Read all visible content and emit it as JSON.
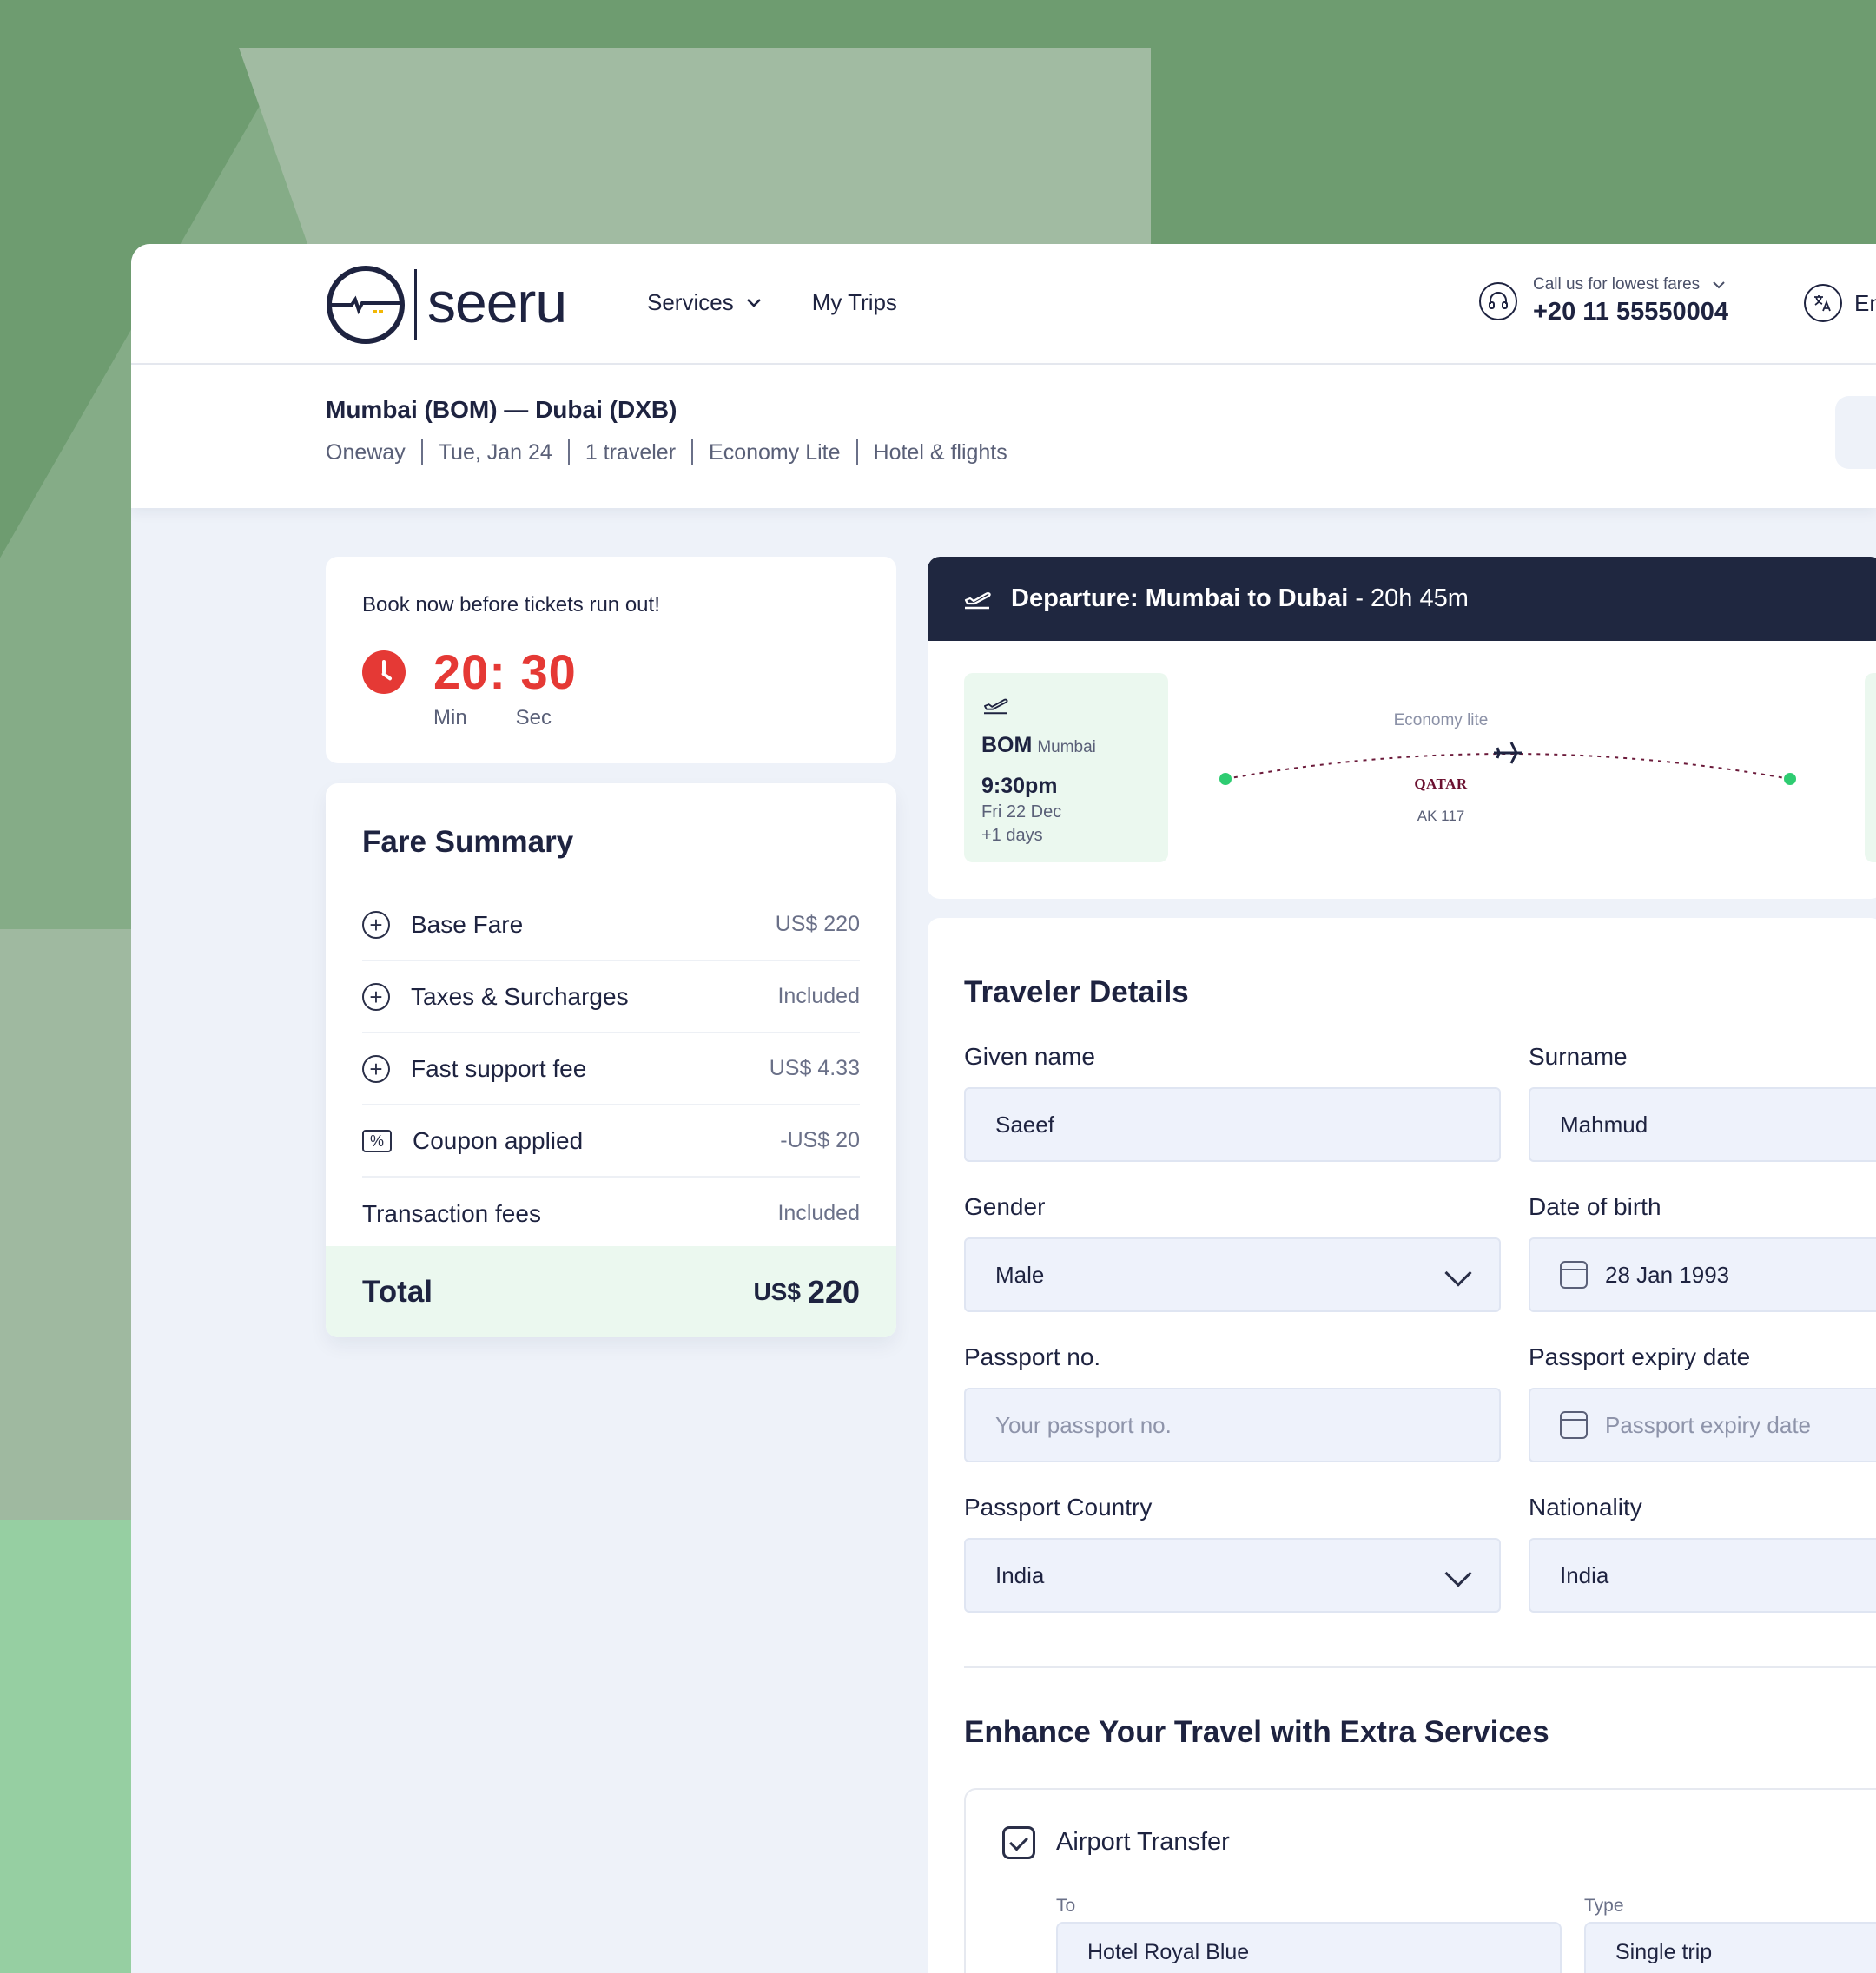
{
  "header": {
    "logo_text": "seeru",
    "nav": [
      {
        "label": "Services",
        "has_dropdown": true
      },
      {
        "label": "My Trips",
        "has_dropdown": false
      }
    ],
    "call_label": "Call us for lowest fares",
    "call_number": "+20 11 55550004",
    "language": "En"
  },
  "search_summary": {
    "route": "Mumbai (BOM) — Dubai (DXB)",
    "trip_type": "Oneway",
    "date": "Tue, Jan 24",
    "travelers": "1 traveler",
    "cabin": "Economy Lite",
    "package": "Hotel & flights"
  },
  "timer": {
    "title": "Book now before tickets run out!",
    "value": "20: 30",
    "unit_min": "Min",
    "unit_sec": "Sec"
  },
  "fare_summary": {
    "title": "Fare Summary",
    "rows": [
      {
        "icon": "plus-circle-icon",
        "label": "Base Fare",
        "value": "US$ 220"
      },
      {
        "icon": "plus-circle-icon",
        "label": "Taxes & Surcharges",
        "value": "Included"
      },
      {
        "icon": "plus-circle-icon",
        "label": "Fast support fee",
        "value": "US$ 4.33"
      },
      {
        "icon": "coupon-icon",
        "label": "Coupon applied",
        "value": "-US$ 20"
      },
      {
        "icon": "",
        "label": "Transaction fees",
        "value": "Included"
      }
    ],
    "total_label": "Total",
    "total_currency": "US$",
    "total_amount": "220"
  },
  "departure": {
    "title": "Departure: Mumbai to Dubai",
    "duration": "- 20h 45m",
    "origin_code": "BOM",
    "origin_city": "Mumbai",
    "origin_time": "9:30pm",
    "origin_date": "Fri 22 Dec",
    "origin_plus": "+1 days",
    "cabin_class": "Economy lite",
    "airline": "QATAR",
    "flight_no": "AK 117"
  },
  "traveler": {
    "title": "Traveler Details",
    "given_name_label": "Given name",
    "given_name": "Saeef",
    "surname_label": "Surname",
    "surname": "Mahmud",
    "gender_label": "Gender",
    "gender": "Male",
    "dob_label": "Date of birth",
    "dob": "28 Jan 1993",
    "passport_no_label": "Passport no.",
    "passport_no_placeholder": "Your passport no.",
    "passport_expiry_label": "Passport expiry date",
    "passport_expiry_placeholder": "Passport expiry date",
    "passport_country_label": "Passport Country",
    "passport_country": "India",
    "nationality_label": "Nationality",
    "nationality": "India"
  },
  "extras": {
    "title": "Enhance Your Travel with Extra Services",
    "airport_transfer_label": "Airport Transfer",
    "to_label": "To",
    "to_value": "Hotel Royal Blue",
    "type_label": "Type",
    "type_value": "Single trip"
  },
  "colors": {
    "accent_red": "#e53935",
    "navy": "#1f2740",
    "mint": "#ebf8ef",
    "field_bg": "#eef2fb",
    "route_dot": "#2ecc71"
  }
}
